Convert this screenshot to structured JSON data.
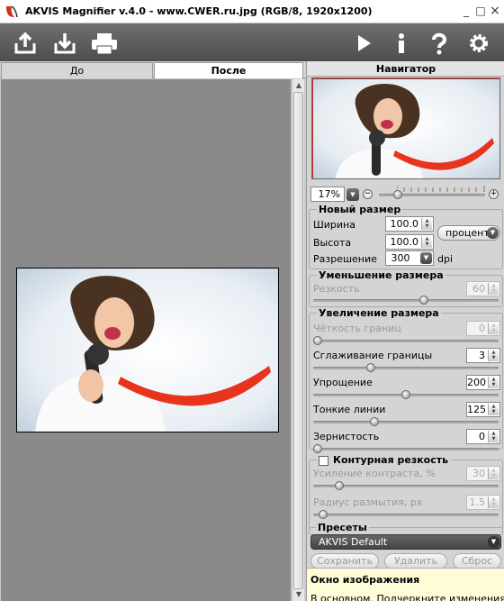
{
  "window": {
    "title": "AKVIS Magnifier v.4.0 - www.CWER.ru.jpg (RGB/8, 1920x1200)",
    "minimize": "_",
    "maximize": "□",
    "close": "×"
  },
  "toolbar": {
    "left_icons": [
      "open-icon",
      "save-icon",
      "print-icon"
    ],
    "right_icons": [
      "run-icon",
      "info-icon",
      "help-icon",
      "settings-icon"
    ]
  },
  "tabs": [
    {
      "label": "До",
      "active": false
    },
    {
      "label": "После",
      "active": true
    }
  ],
  "navigator": {
    "title": "Навигатор",
    "zoom": "17%",
    "zoom_minus": "−",
    "zoom_plus": "+",
    "zoom_level": 0.15
  },
  "new_size": {
    "title": "Новый размер",
    "width_label": "Ширина",
    "width_value": "100.0",
    "height_label": "Высота",
    "height_value": "100.0",
    "units": "проценты",
    "resolution_label": "Разрешение",
    "resolution_value": "300",
    "resolution_unit": "dpi"
  },
  "reduce": {
    "title": "Уменьшение размера",
    "sharpness_label": "Резкость",
    "sharpness_value": "60",
    "sharpness_level": 0.6
  },
  "enlarge": {
    "title": "Увеличение размера",
    "params": [
      {
        "label": "Чёткость границ",
        "value": "0",
        "level": 0.0,
        "disabled": true
      },
      {
        "label": "Сглаживание границы",
        "value": "3",
        "level": 0.3,
        "disabled": false
      },
      {
        "label": "Упрощение",
        "value": "200",
        "level": 0.5,
        "disabled": false
      },
      {
        "label": "Тонкие линии",
        "value": "125",
        "level": 0.32,
        "disabled": false
      },
      {
        "label": "Зернистость",
        "value": "0",
        "level": 0.0,
        "disabled": false
      }
    ]
  },
  "contour": {
    "title": "Контурная резкость",
    "checked": false,
    "contrast_label": "Усиление контраста, %",
    "contrast_value": "30",
    "contrast_level": 0.12,
    "radius_label": "Радиус размытия, px",
    "radius_value": "1.5",
    "radius_level": 0.03
  },
  "presets": {
    "title": "Пресеты",
    "selected": "AKVIS Default",
    "save": "Сохранить",
    "delete": "Удалить",
    "reset": "Сброс"
  },
  "info": {
    "title": "Окно изображения",
    "text": "В основном. Подчеркните изменения"
  },
  "colors": {
    "toolbar": "#5a5a5a",
    "scarf_red": "#e8341c",
    "info_bg": "#fffdd8"
  }
}
